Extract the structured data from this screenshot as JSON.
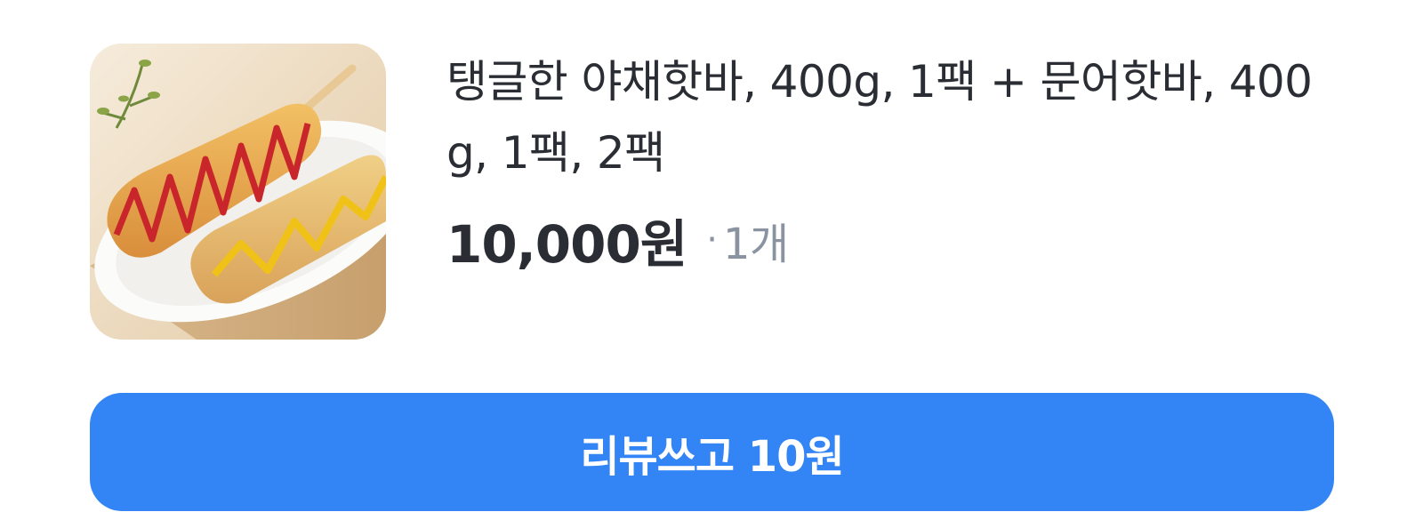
{
  "product": {
    "image_icon": "product-photo-hotbar-skewers",
    "title": "탱글한 야채핫바, 400g, 1팩 + 문어핫바, 400g, 1팩, 2팩",
    "price": "10,000원",
    "separator": "·",
    "quantity": "1개"
  },
  "actions": {
    "review_label": "리뷰쓰고 10원"
  },
  "colors": {
    "accent": "#3384f4",
    "text_primary": "#2a2d33",
    "text_secondary": "#8a93a0"
  }
}
